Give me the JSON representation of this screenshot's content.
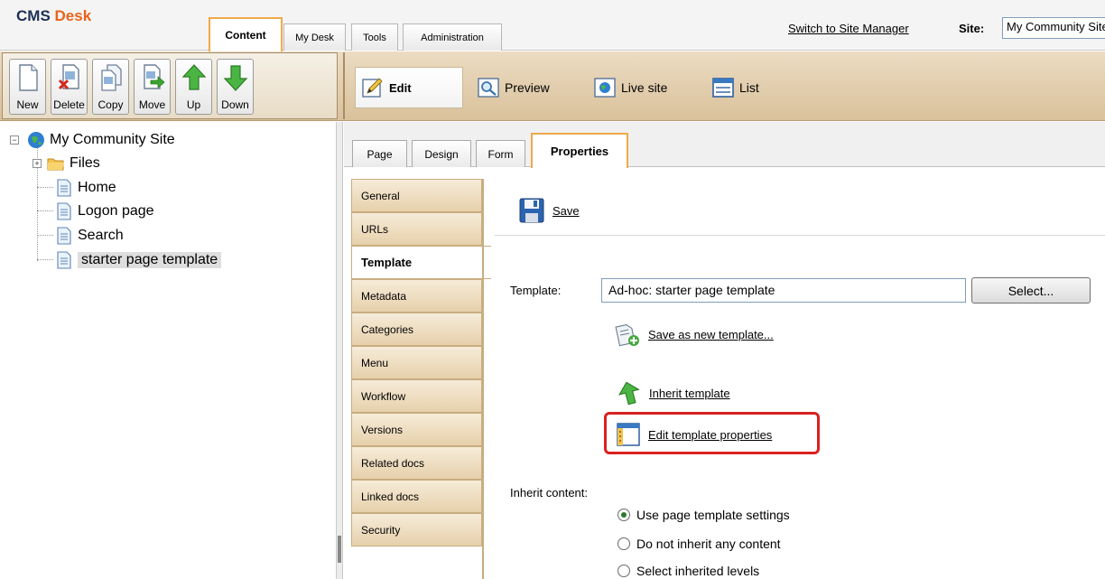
{
  "header": {
    "logo_cms": "CMS",
    "logo_desk": "Desk",
    "tabs": [
      {
        "label": "Content",
        "active": true
      },
      {
        "label": "My Desk",
        "active": false
      },
      {
        "label": "Tools",
        "active": false
      },
      {
        "label": "Administration",
        "active": false
      }
    ],
    "switch_link": "Switch to Site Manager",
    "site_label": "Site:",
    "site_value": "My Community Site"
  },
  "toolbar": {
    "actions": [
      {
        "label": "New",
        "icon": "new-document-icon"
      },
      {
        "label": "Delete",
        "icon": "delete-document-icon"
      },
      {
        "label": "Copy",
        "icon": "copy-document-icon"
      },
      {
        "label": "Move",
        "icon": "move-document-icon"
      },
      {
        "label": "Up",
        "icon": "up-arrow-icon"
      },
      {
        "label": "Down",
        "icon": "down-arrow-icon"
      }
    ],
    "views": [
      {
        "label": "Edit",
        "icon": "edit-pencil-icon",
        "active": true
      },
      {
        "label": "Preview",
        "icon": "preview-magnifier-icon"
      },
      {
        "label": "Live site",
        "icon": "live-site-globe-icon"
      },
      {
        "label": "List",
        "icon": "list-icon"
      }
    ]
  },
  "tree": {
    "root": "My Community Site",
    "items": [
      {
        "label": "Files",
        "icon": "folder-icon"
      },
      {
        "label": "Home",
        "icon": "page-icon"
      },
      {
        "label": "Logon page",
        "icon": "page-icon"
      },
      {
        "label": "Search",
        "icon": "page-icon"
      },
      {
        "label": "starter page template",
        "icon": "page-icon",
        "selected": true
      }
    ]
  },
  "subtabs": [
    {
      "label": "Page"
    },
    {
      "label": "Design"
    },
    {
      "label": "Form"
    },
    {
      "label": "Properties",
      "active": true
    }
  ],
  "side_menu": [
    {
      "label": "General"
    },
    {
      "label": "URLs"
    },
    {
      "label": "Template",
      "active": true
    },
    {
      "label": "Metadata"
    },
    {
      "label": "Categories"
    },
    {
      "label": "Menu"
    },
    {
      "label": "Workflow"
    },
    {
      "label": "Versions"
    },
    {
      "label": "Related docs"
    },
    {
      "label": "Linked docs"
    },
    {
      "label": "Security"
    }
  ],
  "main": {
    "save_label": "Save",
    "template_label": "Template:",
    "template_value": "Ad-hoc: starter page template",
    "select_button": "Select...",
    "save_as_new": "Save as new template...",
    "inherit_template": "Inherit template",
    "edit_properties": "Edit template properties",
    "inherit_content_label": "Inherit content:",
    "radio_options": [
      {
        "label": "Use page template settings",
        "checked": true
      },
      {
        "label": "Do not inherit any content",
        "checked": false
      },
      {
        "label": "Select inherited levels",
        "checked": false
      }
    ]
  },
  "colors": {
    "accent_orange": "#f0a94a",
    "highlight_red": "#d9221f",
    "toolbar_tan": "#d9c19b"
  }
}
